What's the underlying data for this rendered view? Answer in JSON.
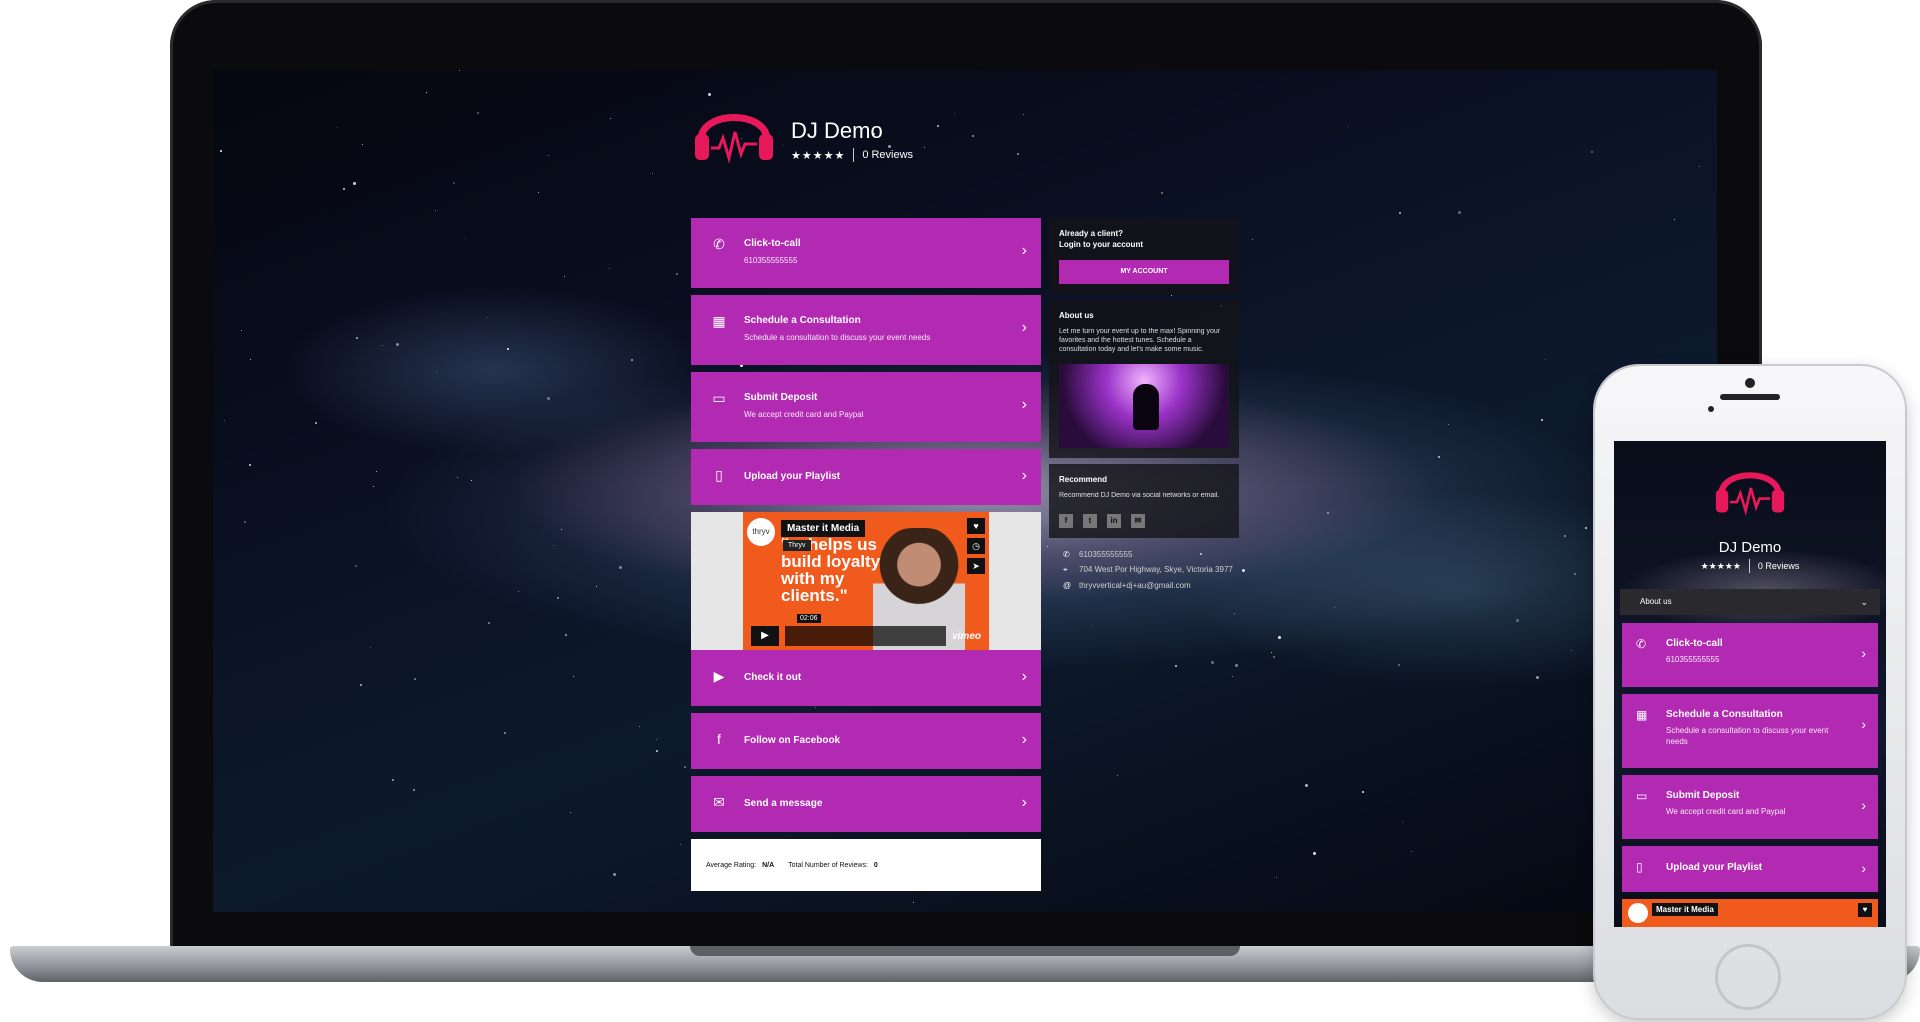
{
  "brand": {
    "name": "DJ Demo",
    "stars": "★★★★★",
    "reviews": "0 Reviews",
    "accent_color": "#b22ab1",
    "logo_color": "#e8195a"
  },
  "actions": [
    {
      "icon": "phone-icon",
      "glyph": "✆",
      "title": "Click-to-call",
      "subtitle": "610355555555"
    },
    {
      "icon": "calendar-icon",
      "glyph": "▦",
      "title": "Schedule a Consultation",
      "subtitle": "Schedule a consultation to discuss your event needs"
    },
    {
      "icon": "money-icon",
      "glyph": "▭",
      "title": "Submit Deposit",
      "subtitle": "We accept credit card and Paypal"
    },
    {
      "icon": "file-icon",
      "glyph": "▯",
      "title": "Upload your Playlist",
      "subtitle": ""
    }
  ],
  "video": {
    "title": "Master it Media",
    "quote": "\"... helps us build loyalty with my clients.\"",
    "badge": "thryv",
    "tag": "Thryv",
    "time": "02:06",
    "player": "vimeo"
  },
  "links": [
    {
      "icon": "play-circle-icon",
      "glyph": "▶",
      "title": "Check it out"
    },
    {
      "icon": "facebook-icon",
      "glyph": "f",
      "title": "Follow on Facebook"
    },
    {
      "icon": "envelope-icon",
      "glyph": "✉",
      "title": "Send a message"
    }
  ],
  "rating": {
    "avg_label": "Average Rating:",
    "avg_value": "N/A",
    "total_label": "Total Number of Reviews:",
    "total_value": "0"
  },
  "client": {
    "line1": "Already a client?",
    "line2": "Login to your account",
    "button": "MY ACCOUNT"
  },
  "about": {
    "heading": "About us",
    "text": "Let me turn your event up to the max! Spinning your favorites and the hottest tunes. Schedule a consultation today and let's make some music."
  },
  "recommend": {
    "heading": "Recommend",
    "text": "Recommend DJ Demo via social networks or email."
  },
  "contact": {
    "phone": "610355555555",
    "address": "704 West Por Highway, Skye, Victoria 3977",
    "email": "thryvvertical+dj+au@gmail.com"
  },
  "phone_view": {
    "about_label": "About us",
    "cards": [
      {
        "icon": "phone-icon",
        "glyph": "✆",
        "title": "Click-to-call",
        "subtitle": "610355555555"
      },
      {
        "icon": "calendar-icon",
        "glyph": "▦",
        "title": "Schedule a Consultation",
        "subtitle": "Schedule a consultation to discuss your event needs"
      },
      {
        "icon": "money-icon",
        "glyph": "▭",
        "title": "Submit Deposit",
        "subtitle": "We accept credit card and Paypal"
      },
      {
        "icon": "file-icon",
        "glyph": "▯",
        "title": "Upload your Playlist",
        "subtitle": ""
      }
    ],
    "video_title": "Master it Media"
  }
}
